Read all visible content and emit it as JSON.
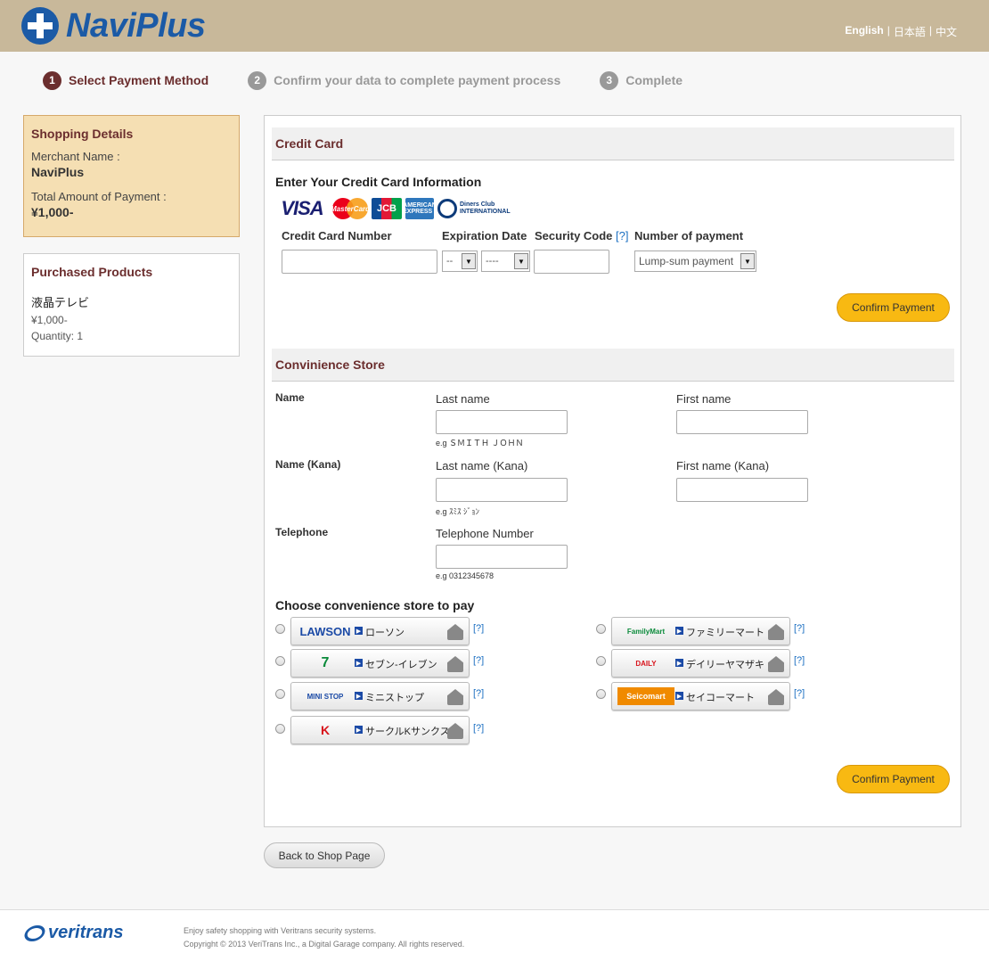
{
  "header": {
    "logo_text": "NaviPlus",
    "languages": [
      "English",
      "日本語",
      "中文"
    ],
    "active_language": "English"
  },
  "steps": [
    {
      "num": "1",
      "label": "Select Payment Method",
      "active": true
    },
    {
      "num": "2",
      "label": "Confirm your data to complete payment process",
      "active": false
    },
    {
      "num": "3",
      "label": "Complete",
      "active": false
    }
  ],
  "shopping": {
    "title": "Shopping Details",
    "merchant_label": "Merchant Name :",
    "merchant_value": "NaviPlus",
    "total_label": "Total Amount of Payment :",
    "total_value": "¥1,000-"
  },
  "products": {
    "title": "Purchased Products",
    "name": "液晶テレビ",
    "price": "¥1,000-",
    "quantity": "Quantity: 1"
  },
  "credit_card": {
    "section_title": "Credit Card",
    "enter_title": "Enter Your Credit Card Information",
    "card_brands": [
      "VISA",
      "MasterCard",
      "JCB",
      "AMERICAN EXPRESS",
      "Diners Club INTERNATIONAL"
    ],
    "number_label": "Credit Card Number",
    "expiration_label": "Expiration Date",
    "security_label": "Security Code",
    "help_mark": "[?]",
    "payments_label": "Number of payment",
    "month_value": "--",
    "year_value": "----",
    "payment_option": "Lump-sum payment",
    "confirm_label": "Confirm Payment"
  },
  "store": {
    "section_title": "Convinience Store",
    "name_label": "Name",
    "last_name_label": "Last name",
    "first_name_label": "First name",
    "name_hint": "e.g ＳＭＩＴＨ ＪＯＨＮ",
    "kana_label": "Name (Kana)",
    "last_kana_label": "Last name (Kana)",
    "first_kana_label": "First name (Kana)",
    "kana_hint": "e.g ｽﾐｽ ｼﾞｮﾝ",
    "tel_label": "Telephone",
    "tel_number_label": "Telephone Number",
    "tel_hint": "e.g 0312345678",
    "choose_title": "Choose convenience store to pay",
    "help_mark": "[?]",
    "stores": [
      {
        "logo": "LAWSON",
        "name": "ローソン",
        "logo_color": "#1b4aa6"
      },
      {
        "logo": "FamilyMart",
        "name": "ファミリーマート",
        "logo_color": "#0a8a3a"
      },
      {
        "logo": "7",
        "name": "セブン-イレブン",
        "logo_color": "#0a8a3a"
      },
      {
        "logo": "DAILY",
        "name": "デイリーヤマザキ",
        "logo_color": "#d8131b"
      },
      {
        "logo": "MINI STOP",
        "name": "ミニストップ",
        "logo_color": "#1b4aa6"
      },
      {
        "logo": "Seicomart",
        "name": "セイコーマート",
        "logo_color": "#f08a00"
      },
      {
        "logo": "K",
        "name": "サークルKサンクス",
        "logo_color": "#d8131b"
      }
    ],
    "confirm_label": "Confirm Payment"
  },
  "back_label": "Back to Shop Page",
  "footer": {
    "logo_text": "veritrans",
    "line1": "Enjoy safety shopping with Veritrans security systems.",
    "line2": "Copyright © 2013 VeriTrans Inc., a Digital Garage company. All rights reserved."
  }
}
